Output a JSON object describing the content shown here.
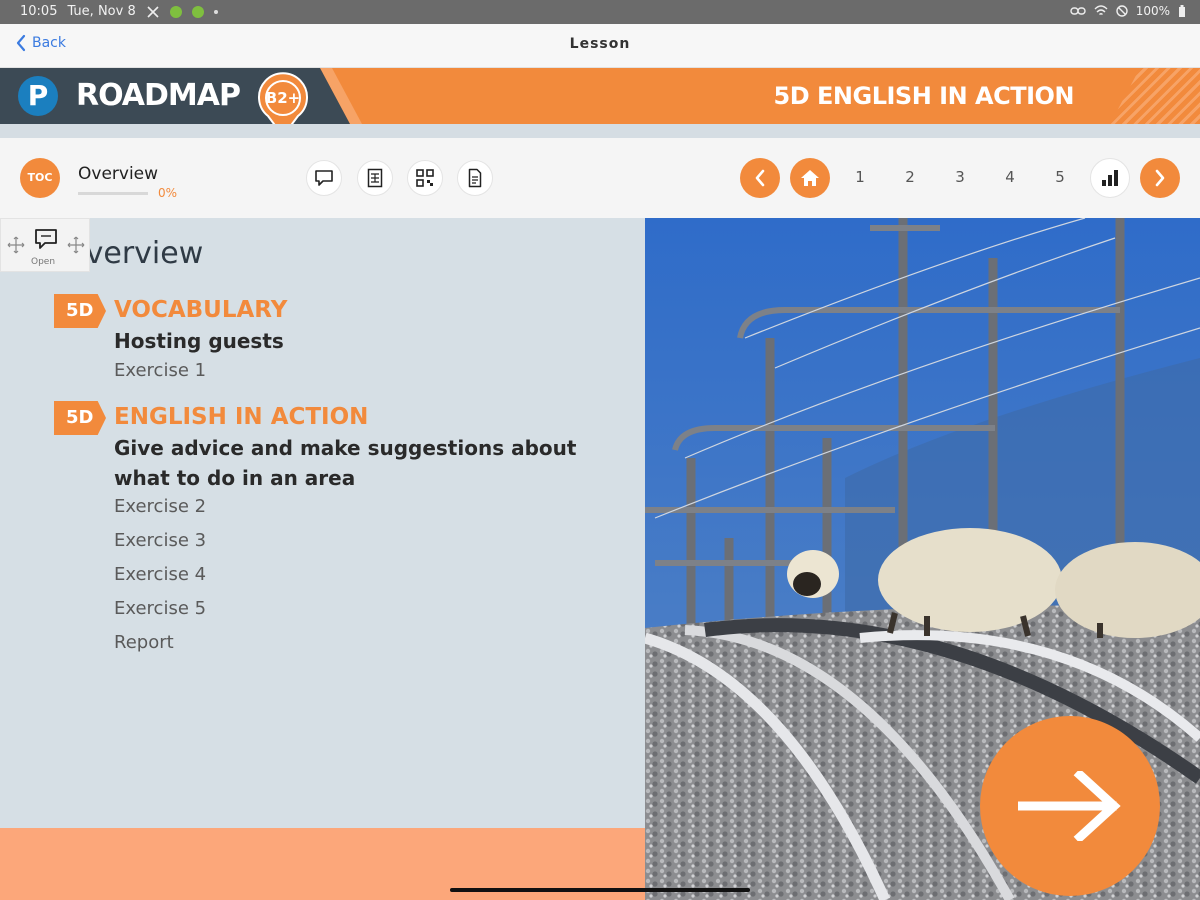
{
  "status_bar": {
    "time": "10:05",
    "date": "Tue, Nov 8",
    "battery": "100%"
  },
  "nav": {
    "back_label": "Back",
    "title": "Lesson"
  },
  "banner": {
    "brand": "ROADMAP",
    "level": "B2+",
    "title": "5D ENGLISH IN ACTION",
    "brand_color": "#f28a3c",
    "dark_color": "#3c4a55"
  },
  "toolbar": {
    "toc_label": "TOC",
    "overview_label": "Overview",
    "progress_text": "0%",
    "progress_value": 0,
    "icons": [
      "speech-bubble-icon",
      "document-grid-icon",
      "qr-code-icon",
      "page-icon"
    ],
    "pages": [
      "1",
      "2",
      "3",
      "4",
      "5"
    ]
  },
  "open_chip": {
    "label": "Open"
  },
  "content": {
    "heading": "Overview",
    "sections": [
      {
        "badge": "5D",
        "title": "VOCABULARY",
        "subtitle": "Hosting guests",
        "items": [
          "Exercise 1"
        ]
      },
      {
        "badge": "5D",
        "title": "ENGLISH IN ACTION",
        "subtitle": "Give advice and make suggestions about what to do in an area",
        "items": [
          "Exercise 2",
          "Exercise 3",
          "Exercise 4",
          "Exercise 5",
          "Report"
        ]
      }
    ]
  }
}
